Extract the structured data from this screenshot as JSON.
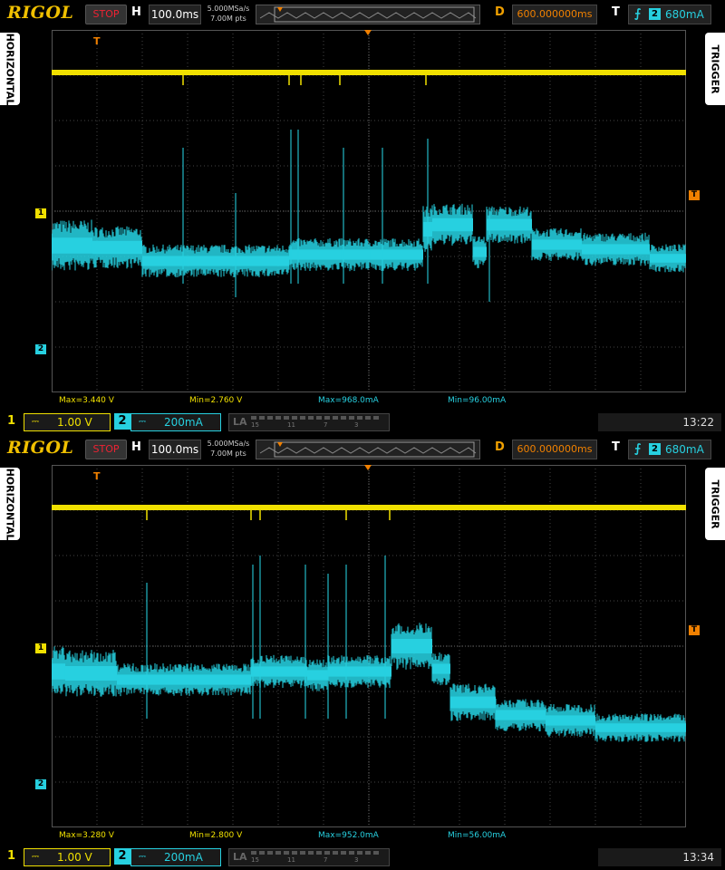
{
  "screens": [
    {
      "logo": "RIGOL",
      "run_state": "STOP",
      "horizontal_label": "H",
      "timebase": "100.0ms",
      "sample_rate": "5.000MSa/s",
      "memory_depth": "7.00M pts",
      "delay_label": "D",
      "delay": "600.000000ms",
      "trigger_label": "T",
      "trigger_source": "2",
      "trigger_level": "680mA",
      "left_tab": "HORIZONTAL",
      "right_tab": "TRIGGER",
      "measurements": [
        "Max=3.440 V",
        "Min=2.760 V",
        "Max=968.0mA",
        "Min=96.00mA"
      ],
      "ch1": {
        "number": "1",
        "coupling": "⎓",
        "scale": "1.00 V",
        "marker": "1"
      },
      "ch2": {
        "number": "2",
        "coupling": "⎓",
        "scale": "200mA",
        "marker": "2"
      },
      "la": {
        "label": "LA",
        "bits": [
          "15",
          "11",
          "7",
          "3"
        ]
      },
      "clock": "13:22",
      "trigger_marker": "T",
      "colors": {
        "ch1": "#f0e000",
        "ch2": "#27d0e0",
        "accent": "#f08000"
      }
    },
    {
      "logo": "RIGOL",
      "run_state": "STOP",
      "horizontal_label": "H",
      "timebase": "100.0ms",
      "sample_rate": "5.000MSa/s",
      "memory_depth": "7.00M pts",
      "delay_label": "D",
      "delay": "600.000000ms",
      "trigger_label": "T",
      "trigger_source": "2",
      "trigger_level": "680mA",
      "left_tab": "HORIZONTAL",
      "right_tab": "TRIGGER",
      "measurements": [
        "Max=3.280 V",
        "Min=2.800 V",
        "Max=952.0mA",
        "Min=56.00mA"
      ],
      "ch1": {
        "number": "1",
        "coupling": "⎓",
        "scale": "1.00 V",
        "marker": "1"
      },
      "ch2": {
        "number": "2",
        "coupling": "⎓",
        "scale": "200mA",
        "marker": "2"
      },
      "la": {
        "label": "LA",
        "bits": [
          "15",
          "11",
          "7",
          "3"
        ]
      },
      "clock": "13:34",
      "trigger_marker": "T",
      "colors": {
        "ch1": "#f0e000",
        "ch2": "#27d0e0",
        "accent": "#f08000"
      }
    }
  ]
}
